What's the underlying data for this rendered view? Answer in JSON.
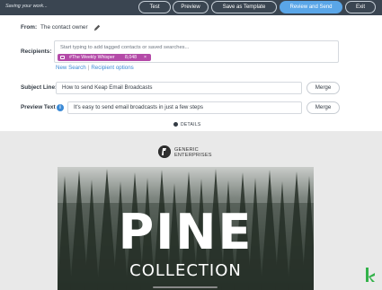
{
  "topbar": {
    "status": "Saving your work...",
    "buttons": {
      "test": "Test",
      "preview": "Preview",
      "save_template": "Save as Template",
      "review_send": "Review and Send",
      "exit": "Exit"
    }
  },
  "form": {
    "from_label": "From:",
    "from_value": "The contact owner",
    "recipients_label": "Recipients:",
    "recipients_placeholder": "Start typing to add tagged contacts or saved searches...",
    "tag": {
      "name": "#The Weekly Whisper",
      "count": "8,048",
      "remove": "×"
    },
    "new_search": "New Search",
    "link_separator": "|",
    "recipient_options": "Recipient options",
    "subject_label": "Subject Line:",
    "subject_value": "How to send Keap Email Broadcasts",
    "preview_label": "Preview Text",
    "preview_value": "It's easy to send email broadcasts in just a few steps",
    "merge_label": "Merge",
    "info_icon": "i",
    "details_label": "DETAILS"
  },
  "email_preview": {
    "brand_line1": "GENERIC",
    "brand_line2": "ENTERPRISES",
    "hero_title": "PINE",
    "hero_subtitle": "COLLECTION"
  },
  "colors": {
    "topbar": "#3a4551",
    "primary": "#5aa6e8",
    "tag": "#b44aa8",
    "link": "#3b8ad6",
    "keap_green": "#33b24a"
  },
  "icons": [
    "pencil-icon",
    "tag-icon",
    "info-icon",
    "chevron-icon",
    "brand-logo-icon",
    "keap-icon"
  ]
}
